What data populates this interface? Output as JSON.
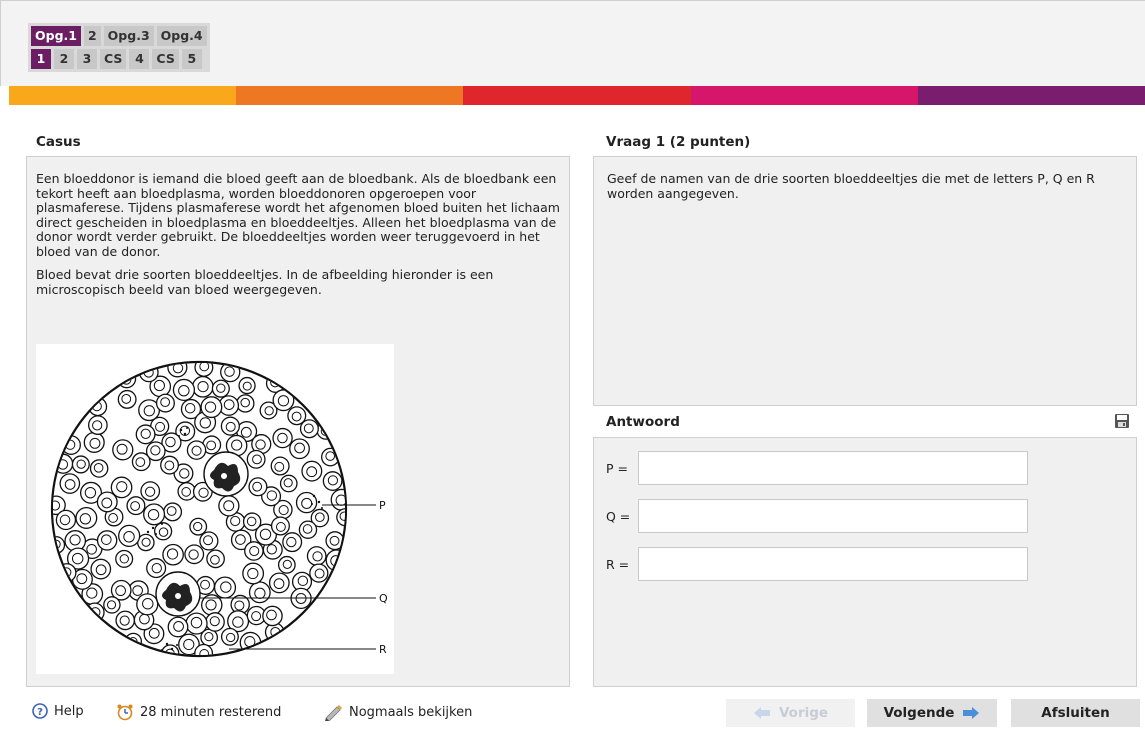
{
  "tabs": {
    "top": [
      {
        "label": "Opg.1",
        "active": true
      },
      {
        "label": "2",
        "active": false
      },
      {
        "label": "Opg.3",
        "active": false
      },
      {
        "label": "Opg.4",
        "active": false
      }
    ],
    "sub": [
      {
        "label": "1",
        "active": true
      },
      {
        "label": "2",
        "active": false
      },
      {
        "label": "3",
        "active": false
      },
      {
        "label": "CS",
        "active": false
      },
      {
        "label": "4",
        "active": false
      },
      {
        "label": "CS",
        "active": false
      },
      {
        "label": "5",
        "active": false
      }
    ]
  },
  "colors": {
    "bar": [
      "#f8a81a",
      "#ee7724",
      "#e0262d",
      "#d6166b",
      "#7a1d6e"
    ],
    "accent": "#6b1e63",
    "nav_icon": "#4a90d9",
    "nav_icon_disabled": "#c7d6ea"
  },
  "casus": {
    "title": "Casus",
    "paragraph1": "Een bloeddonor is iemand die bloed geeft aan de bloedbank. Als de bloedbank een tekort heeft aan bloedplasma, worden bloeddonoren opgeroepen voor plasmaferese. Tijdens plasmaferese wordt het afgenomen bloed buiten het lichaam direct gescheiden in bloedplasma en bloeddeeltjes. Alleen het bloedplasma van de donor wordt verder gebruikt. De bloeddeeltjes worden weer teruggevoerd in het bloed van de donor.",
    "paragraph2": "Bloed bevat drie soorten bloeddeeltjes. In de afbeelding hieronder is een microscopisch beeld van bloed weergegeven.",
    "figure_labels": {
      "p": "P",
      "q": "Q",
      "r": "R"
    }
  },
  "question": {
    "title": "Vraag 1 (2 punten)",
    "text": "Geef de namen van de drie soorten bloeddeeltjes die met de letters P, Q en R worden aangegeven."
  },
  "answer": {
    "title": "Antwoord",
    "fields": [
      {
        "label": "P =",
        "value": ""
      },
      {
        "label": "Q =",
        "value": ""
      },
      {
        "label": "R =",
        "value": ""
      }
    ]
  },
  "footer": {
    "help_label": "Help",
    "time_label": "28 minuten resterend",
    "review_label": "Nogmaals bekijken",
    "prev_label": "Vorige",
    "next_label": "Volgende",
    "finish_label": "Afsluiten"
  }
}
